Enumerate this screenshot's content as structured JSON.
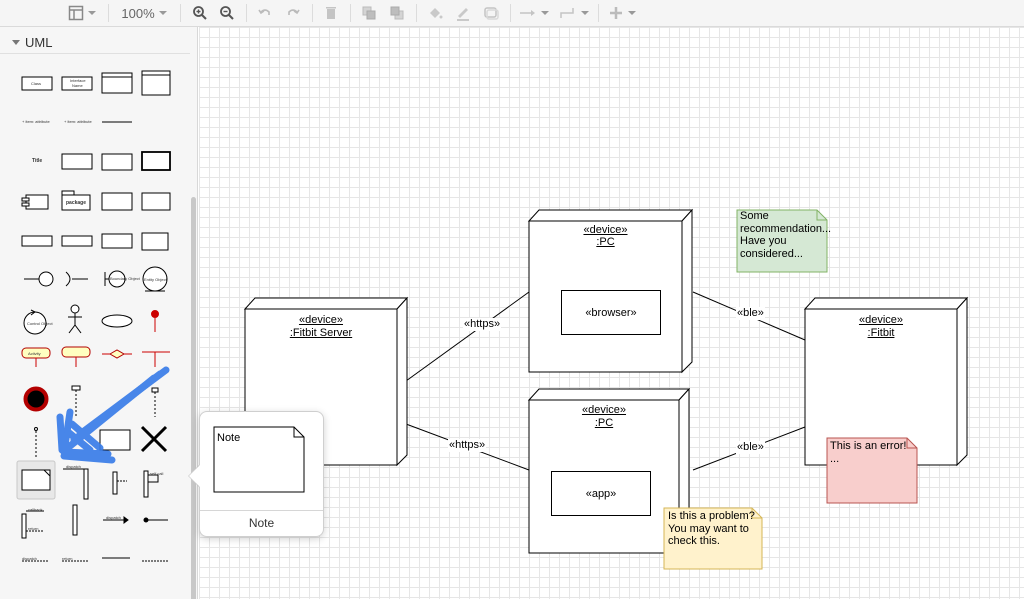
{
  "toolbar": {
    "zoom_label": "100%",
    "buttons": [
      "format-panel",
      "zoom-in",
      "zoom-out",
      "undo",
      "redo",
      "delete",
      "to-front",
      "to-back",
      "fill-color",
      "line-color",
      "shadow",
      "connection",
      "waypoints",
      "insert"
    ]
  },
  "sidebar": {
    "section_label": "UML",
    "shapes": {
      "class_label": "Class",
      "interface_label": "Interface",
      "interface_name": "Name",
      "title_label": "Title",
      "package_label": "package",
      "boundary_label": "Boundary Object",
      "entity_label": "Entity Object",
      "control_label": "Control Object",
      "item_attr": "+ item: attribute",
      "activity_label": "Activity",
      "dispatch_label": "dispatch",
      "callback_label": "callback",
      "return_label": "return",
      "self_call_label": "self call"
    }
  },
  "tooltip": {
    "title": "Note",
    "preview_text": "Note"
  },
  "diagram": {
    "nodes": [
      {
        "stereotype": "«device»",
        "name": ":Fitbit Server"
      },
      {
        "stereotype": "«device»",
        "name": ":PC",
        "inner": "«browser»"
      },
      {
        "stereotype": "«device»",
        "name": ":PC",
        "inner": "«app»"
      },
      {
        "stereotype": "«device»",
        "name": ":Fitbit"
      }
    ],
    "edges": [
      {
        "label": "«https»"
      },
      {
        "label": "«https»"
      },
      {
        "label": "«ble»"
      },
      {
        "label": "«ble»"
      }
    ],
    "notes": [
      {
        "lines": [
          "Some",
          "recommendation...",
          "Have you",
          "considered..."
        ],
        "fill": "#d5e8d4",
        "stroke": "#82b366"
      },
      {
        "lines": [
          "This is an error!",
          "..."
        ],
        "fill": "#f8cecc",
        "stroke": "#b85450"
      },
      {
        "lines": [
          "Is this a problem?",
          "You may want to",
          "check this."
        ],
        "fill": "#fff2cc",
        "stroke": "#d6b656"
      }
    ]
  },
  "colors": {
    "scribble": "#3a7de8",
    "grid": "#e6e6e6",
    "toolbar_bg": "#f5f5f5",
    "sidebar_bg": "#f6f6f6"
  }
}
